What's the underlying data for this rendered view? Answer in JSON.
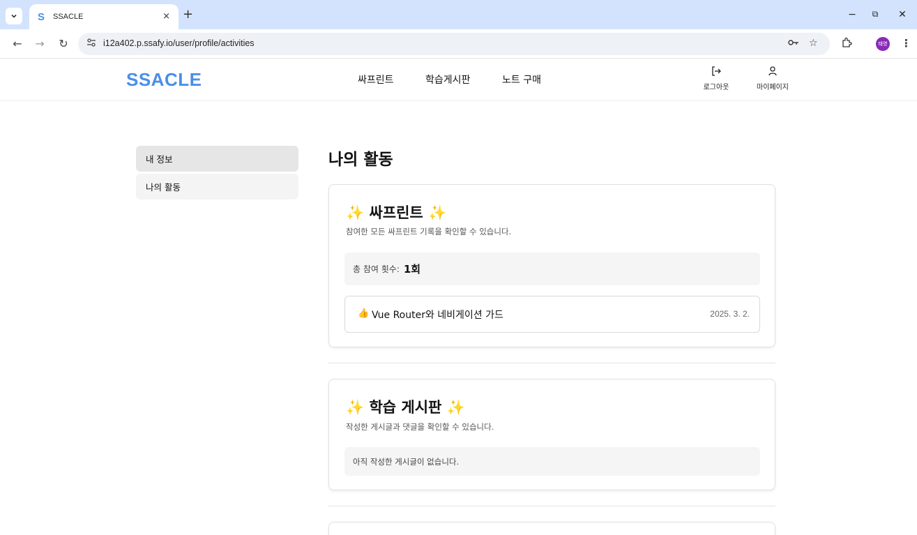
{
  "browser": {
    "tab_menu_icon": "chevron-down",
    "tab": {
      "favicon": "S",
      "title": "SSACLE",
      "close": "×"
    },
    "new_tab": "+",
    "window": {
      "minimize": "−",
      "restore": "⧉",
      "close": "✕"
    },
    "nav": {
      "back": "←",
      "forward": "→",
      "reload": "↻"
    },
    "url": "i12a402.p.ssafy.io/user/profile/activities",
    "profile_initials": "태영"
  },
  "site": {
    "logo": "SSACLE",
    "brand_color": "#4a8fe8",
    "nav": [
      "싸프린트",
      "학습게시판",
      "노트 구매"
    ],
    "actions": {
      "logout": "로그아웃",
      "mypage": "마이페이지"
    }
  },
  "sidebar": {
    "items": [
      {
        "label": "내 정보",
        "active": true
      },
      {
        "label": "나의 활동",
        "active": false
      }
    ]
  },
  "main": {
    "title": "나의 활동",
    "sprint": {
      "spark_left": "✨",
      "title": "싸프린트",
      "spark_right": "✨",
      "desc": "참여한 모든 싸프린트 기록을 확인할 수 있습니다.",
      "count_label": "총 참여 횟수:",
      "count_value": "1회",
      "records": [
        {
          "emoji": "👍",
          "title": "Vue Router와 네비게이션 가드",
          "date": "2025. 3. 2."
        }
      ]
    },
    "board": {
      "spark_left": "✨",
      "title": "학습 게시판",
      "spark_right": "✨",
      "desc": "작성한 게시글과 댓글을 확인할 수 있습니다.",
      "empty": "아직 작성한 게시글이 없습니다."
    }
  }
}
